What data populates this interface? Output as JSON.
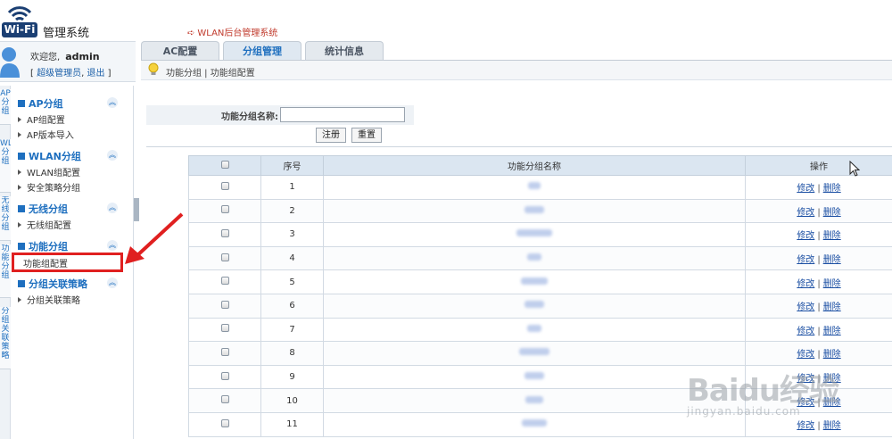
{
  "header": {
    "logo_text": "Wi-Fi",
    "system_name": "管理系统",
    "top_title": "WLAN后台管理系统"
  },
  "user": {
    "welcome": "欢迎您,",
    "name": "admin",
    "bracket_open": "[",
    "role_link": "超级管理员",
    "comma": ",",
    "logout_link": "退出",
    "bracket_close": "]"
  },
  "tabs": [
    {
      "label": "AC配置",
      "active": false
    },
    {
      "label": "分组管理",
      "active": true
    },
    {
      "label": "统计信息",
      "active": false
    }
  ],
  "breadcrumb": {
    "text": "功能分组 | 功能组配置"
  },
  "vtabs": [
    "AP分组",
    "WLAN分组",
    "无线分组",
    "功能分组",
    "分组关联策略"
  ],
  "sidebar": [
    {
      "title": "AP分组",
      "items": [
        "AP组配置",
        "AP版本导入"
      ]
    },
    {
      "title": "WLAN分组",
      "items": [
        "WLAN组配置",
        "安全策略分组"
      ]
    },
    {
      "title": "无线分组",
      "items": [
        "无线组配置"
      ]
    },
    {
      "title": "功能分组",
      "items": [
        "功能组配置"
      ]
    },
    {
      "title": "分组关联策略",
      "items": [
        "分组关联策略"
      ]
    }
  ],
  "form": {
    "label": "功能分组名称:",
    "input_value": "",
    "register_label": "注册",
    "reset_label": "重置"
  },
  "table": {
    "headers": [
      "",
      "序号",
      "功能分组名称",
      "操作"
    ],
    "rows": [
      {
        "seq": "1"
      },
      {
        "seq": "2"
      },
      {
        "seq": "3"
      },
      {
        "seq": "4"
      },
      {
        "seq": "5"
      },
      {
        "seq": "6"
      },
      {
        "seq": "7"
      },
      {
        "seq": "8"
      },
      {
        "seq": "9"
      },
      {
        "seq": "10"
      },
      {
        "seq": "11"
      }
    ],
    "edit_label": "修改",
    "separator": "|",
    "delete_label": "删除"
  },
  "watermark": {
    "main": "Baidu经验",
    "sub": "jingyan.baidu.com"
  },
  "colors": {
    "accent": "#1e6fbf",
    "highlight": "#e02020",
    "logo": "#1b3f73"
  }
}
